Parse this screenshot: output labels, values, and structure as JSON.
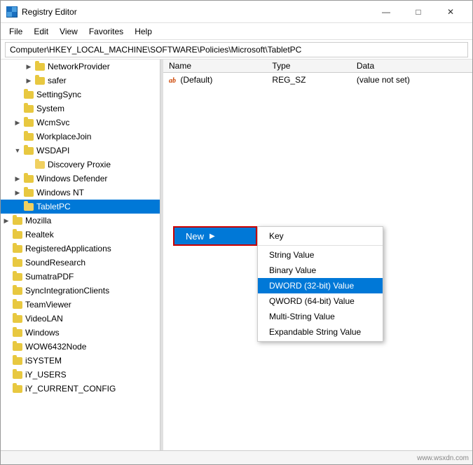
{
  "window": {
    "title": "Registry Editor",
    "icon": "🗂"
  },
  "title_controls": {
    "minimize": "—",
    "maximize": "□",
    "close": "✕"
  },
  "menu": {
    "items": [
      "File",
      "Edit",
      "View",
      "Favorites",
      "Help"
    ]
  },
  "address_bar": {
    "label": "Computer\\HKEY_LOCAL_MACHINE\\SOFTWARE\\Policies\\Microsoft\\TabletPC"
  },
  "tree": {
    "items": [
      {
        "indent": 2,
        "expanded": false,
        "label": "NetworkProvider",
        "level": 2
      },
      {
        "indent": 2,
        "expanded": false,
        "label": "safer",
        "level": 2
      },
      {
        "indent": 1,
        "expanded": false,
        "label": "SettingSync",
        "level": 1
      },
      {
        "indent": 1,
        "expanded": false,
        "label": "System",
        "level": 1
      },
      {
        "indent": 1,
        "expanded": false,
        "label": "WcmSvc",
        "level": 2
      },
      {
        "indent": 1,
        "expanded": false,
        "label": "WorkplaceJoin",
        "level": 1
      },
      {
        "indent": 1,
        "expanded": true,
        "label": "WSDAPI",
        "level": 1
      },
      {
        "indent": 2,
        "expanded": false,
        "label": "Discovery Proxie",
        "level": 2
      },
      {
        "indent": 1,
        "expanded": false,
        "label": "Windows Defender",
        "level": 2
      },
      {
        "indent": 1,
        "expanded": false,
        "label": "Windows NT",
        "level": 2
      },
      {
        "indent": 1,
        "selected": true,
        "label": "TabletPC",
        "level": 1
      },
      {
        "indent": 0,
        "expanded": false,
        "label": "Mozilla",
        "level": 0
      },
      {
        "indent": 0,
        "expanded": false,
        "label": "Realtek",
        "level": 0
      },
      {
        "indent": 0,
        "expanded": false,
        "label": "RegisteredApplications",
        "level": 0
      },
      {
        "indent": 0,
        "expanded": false,
        "label": "SoundResearch",
        "level": 0
      },
      {
        "indent": 0,
        "expanded": false,
        "label": "SumatraPDF",
        "level": 0
      },
      {
        "indent": 0,
        "expanded": false,
        "label": "SyncIntegrationClients",
        "level": 0
      },
      {
        "indent": 0,
        "expanded": false,
        "label": "TeamViewer",
        "level": 0
      },
      {
        "indent": 0,
        "expanded": false,
        "label": "VideoLAN",
        "level": 0
      },
      {
        "indent": 0,
        "expanded": false,
        "label": "Windows",
        "level": 0
      },
      {
        "indent": 0,
        "expanded": false,
        "label": "WOW6432Node",
        "level": 0
      },
      {
        "indent": 0,
        "expanded": false,
        "label": "iSYSTEM",
        "level": 0
      },
      {
        "indent": 0,
        "expanded": false,
        "label": "iY_USERS",
        "level": 0
      },
      {
        "indent": 0,
        "expanded": false,
        "label": "iY_CURRENT_CONFIG",
        "level": 0
      }
    ]
  },
  "registry_table": {
    "columns": [
      "Name",
      "Type",
      "Data"
    ],
    "rows": [
      {
        "icon": "ab",
        "name": "(Default)",
        "type": "REG_SZ",
        "data": "(value not set)"
      }
    ]
  },
  "context_menu": {
    "trigger_label": "New",
    "trigger_arrow": "▶",
    "items": [
      {
        "label": "Key",
        "highlighted": false
      },
      {
        "separator": true
      },
      {
        "label": "String Value",
        "highlighted": false
      },
      {
        "label": "Binary Value",
        "highlighted": false
      },
      {
        "label": "DWORD (32-bit) Value",
        "highlighted": true
      },
      {
        "label": "QWORD (64-bit) Value",
        "highlighted": false
      },
      {
        "label": "Multi-String Value",
        "highlighted": false
      },
      {
        "label": "Expandable String Value",
        "highlighted": false
      }
    ]
  },
  "watermark": "www.wsxdn.com"
}
